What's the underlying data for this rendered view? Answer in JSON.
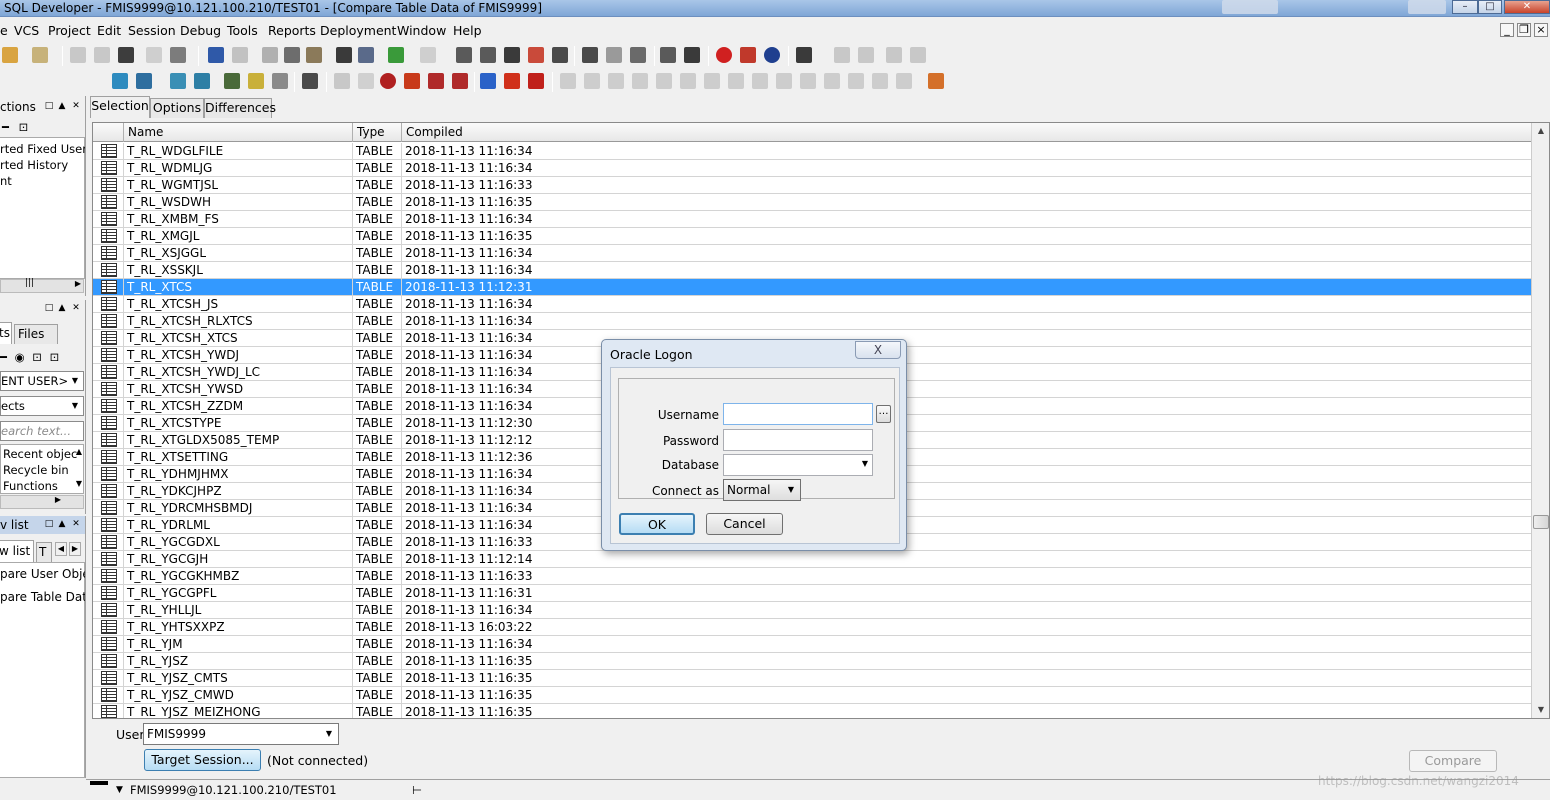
{
  "window": {
    "title": "SQL Developer - FMIS9999@10.121.100.210/TEST01 - [Compare Table Data of FMIS9999]"
  },
  "menu": [
    "e",
    "VCS",
    "Project",
    "Edit",
    "Session",
    "Debug",
    "Tools",
    "Reports",
    "Deployment",
    "Window",
    "Help"
  ],
  "left_panels": {
    "connections": {
      "title": "ctions",
      "items": [
        "rted Fixed Users",
        "rted History",
        "nt"
      ]
    },
    "objects": {
      "tabs": [
        "ts",
        "Files"
      ],
      "user_combo": "ENT USER>",
      "type_combo": "ects",
      "search_placeholder": "earch text...",
      "items": [
        "Recent objec",
        "Recycle bin",
        "Functions"
      ]
    },
    "window_list": {
      "title": "v list",
      "tabs": [
        "w list",
        "T"
      ],
      "items": [
        "pare User Objec",
        "pare Table Data"
      ]
    }
  },
  "tabs": [
    "Selection",
    "Options",
    "Differences"
  ],
  "table": {
    "columns": [
      "Name",
      "Type",
      "Compiled"
    ],
    "selected_index": 8,
    "rows": [
      {
        "name": "T_RL_WDGLFILE",
        "type": "TABLE",
        "compiled": "2018-11-13 11:16:34"
      },
      {
        "name": "T_RL_WDMLJG",
        "type": "TABLE",
        "compiled": "2018-11-13 11:16:34"
      },
      {
        "name": "T_RL_WGMTJSL",
        "type": "TABLE",
        "compiled": "2018-11-13 11:16:33"
      },
      {
        "name": "T_RL_WSDWH",
        "type": "TABLE",
        "compiled": "2018-11-13 11:16:35"
      },
      {
        "name": "T_RL_XMBM_FS",
        "type": "TABLE",
        "compiled": "2018-11-13 11:16:34"
      },
      {
        "name": "T_RL_XMGJL",
        "type": "TABLE",
        "compiled": "2018-11-13 11:16:35"
      },
      {
        "name": "T_RL_XSJGGL",
        "type": "TABLE",
        "compiled": "2018-11-13 11:16:34"
      },
      {
        "name": "T_RL_XSSKJL",
        "type": "TABLE",
        "compiled": "2018-11-13 11:16:34"
      },
      {
        "name": "T_RL_XTCS",
        "type": "TABLE",
        "compiled": "2018-11-13 11:12:31"
      },
      {
        "name": "T_RL_XTCSH_JS",
        "type": "TABLE",
        "compiled": "2018-11-13 11:16:34"
      },
      {
        "name": "T_RL_XTCSH_RLXTCS",
        "type": "TABLE",
        "compiled": "2018-11-13 11:16:34"
      },
      {
        "name": "T_RL_XTCSH_XTCS",
        "type": "TABLE",
        "compiled": "2018-11-13 11:16:34"
      },
      {
        "name": "T_RL_XTCSH_YWDJ",
        "type": "TABLE",
        "compiled": "2018-11-13 11:16:34"
      },
      {
        "name": "T_RL_XTCSH_YWDJ_LC",
        "type": "TABLE",
        "compiled": "2018-11-13 11:16:34"
      },
      {
        "name": "T_RL_XTCSH_YWSD",
        "type": "TABLE",
        "compiled": "2018-11-13 11:16:34"
      },
      {
        "name": "T_RL_XTCSH_ZZDM",
        "type": "TABLE",
        "compiled": "2018-11-13 11:16:34"
      },
      {
        "name": "T_RL_XTCSTYPE",
        "type": "TABLE",
        "compiled": "2018-11-13 11:12:30"
      },
      {
        "name": "T_RL_XTGLDX5085_TEMP",
        "type": "TABLE",
        "compiled": "2018-11-13 11:12:12"
      },
      {
        "name": "T_RL_XTSETTING",
        "type": "TABLE",
        "compiled": "2018-11-13 11:12:36"
      },
      {
        "name": "T_RL_YDHMJHMX",
        "type": "TABLE",
        "compiled": "2018-11-13 11:16:34"
      },
      {
        "name": "T_RL_YDKCJHPZ",
        "type": "TABLE",
        "compiled": "2018-11-13 11:16:34"
      },
      {
        "name": "T_RL_YDRCMHSBMDJ",
        "type": "TABLE",
        "compiled": "2018-11-13 11:16:34"
      },
      {
        "name": "T_RL_YDRLML",
        "type": "TABLE",
        "compiled": "2018-11-13 11:16:34"
      },
      {
        "name": "T_RL_YGCGDXL",
        "type": "TABLE",
        "compiled": "2018-11-13 11:16:33"
      },
      {
        "name": "T_RL_YGCGJH",
        "type": "TABLE",
        "compiled": "2018-11-13 11:12:14"
      },
      {
        "name": "T_RL_YGCGKHMBZ",
        "type": "TABLE",
        "compiled": "2018-11-13 11:16:33"
      },
      {
        "name": "T_RL_YGCGPFL",
        "type": "TABLE",
        "compiled": "2018-11-13 11:16:31"
      },
      {
        "name": "T_RL_YHLLJL",
        "type": "TABLE",
        "compiled": "2018-11-13 11:16:34"
      },
      {
        "name": "T_RL_YHTSXXPZ",
        "type": "TABLE",
        "compiled": "2018-11-13 16:03:22"
      },
      {
        "name": "T_RL_YJM",
        "type": "TABLE",
        "compiled": "2018-11-13 11:16:34"
      },
      {
        "name": "T_RL_YJSZ",
        "type": "TABLE",
        "compiled": "2018-11-13 11:16:35"
      },
      {
        "name": "T_RL_YJSZ_CMTS",
        "type": "TABLE",
        "compiled": "2018-11-13 11:16:35"
      },
      {
        "name": "T_RL_YJSZ_CMWD",
        "type": "TABLE",
        "compiled": "2018-11-13 11:16:35"
      },
      {
        "name": "T_RL_YJSZ_MEIZHONG",
        "type": "TABLE",
        "compiled": "2018-11-13 11:16:35"
      }
    ]
  },
  "bottom": {
    "user_label": "User",
    "user_value": "FMIS9999",
    "target_session_label": "Target Session...",
    "connection_status": "(Not connected)",
    "compare_label": "Compare"
  },
  "statusbar": {
    "connection": "FMIS9999@10.121.100.210/TEST01"
  },
  "watermark": "https://blog.csdn.net/wangzi2014",
  "dialog": {
    "title": "Oracle Logon",
    "close": "X",
    "username_label": "Username",
    "username_value": "",
    "password_label": "Password",
    "database_label": "Database",
    "connect_as_label": "Connect as",
    "connect_as_value": "Normal",
    "ok_label": "OK",
    "cancel_label": "Cancel"
  }
}
